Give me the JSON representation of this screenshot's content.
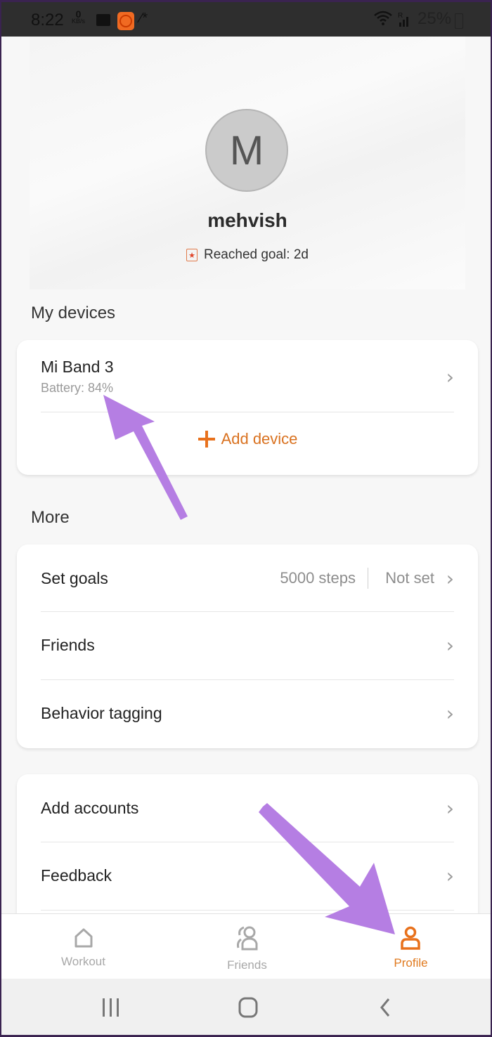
{
  "status_bar": {
    "time": "8:22",
    "net_speed_value": "0",
    "net_speed_unit": "KB/s",
    "battery_percent": "25%",
    "icons": [
      "gallery-icon",
      "mi-fit-icon",
      "magic-wand-icon",
      "wifi-icon",
      "signal-icon",
      "battery-icon"
    ]
  },
  "profile": {
    "avatar_initial": "M",
    "username": "mehvish",
    "goal_text": "Reached goal: 2d",
    "goal_icon": "star-badge-icon"
  },
  "devices_section": {
    "title": "My devices",
    "device_name": "Mi Band 3",
    "device_battery": "Battery: 84%",
    "add_device_label": "Add device",
    "add_icon": "plus-icon"
  },
  "more_section": {
    "title": "More",
    "items": [
      {
        "label": "Set goals",
        "value1": "5000 steps",
        "value2": "Not set"
      },
      {
        "label": "Friends"
      },
      {
        "label": "Behavior tagging"
      }
    ]
  },
  "accounts_section": {
    "items": [
      {
        "label": "Add accounts"
      },
      {
        "label": "Feedback"
      }
    ]
  },
  "bottom_nav": {
    "items": [
      {
        "label": "Workout",
        "icon": "home-icon",
        "active": false
      },
      {
        "label": "Friends",
        "icon": "friends-icon",
        "active": false
      },
      {
        "label": "Profile",
        "icon": "profile-icon",
        "active": true
      }
    ]
  },
  "colors": {
    "accent": "#e8711c",
    "annotation_arrow": "#b57ee3",
    "inactive": "#a8a8a8"
  }
}
